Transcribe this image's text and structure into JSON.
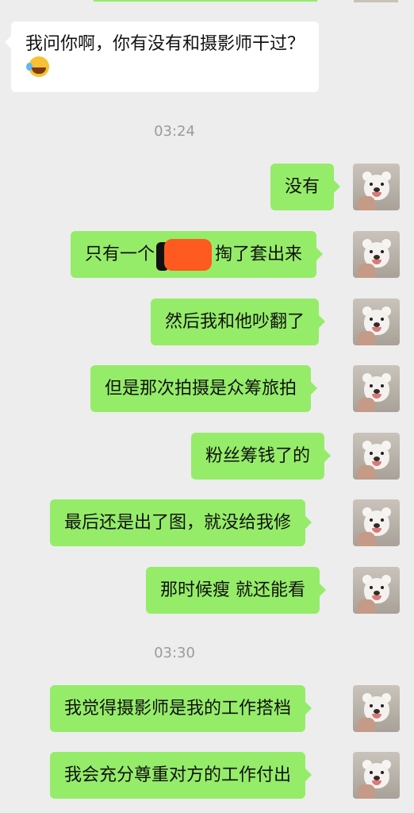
{
  "incoming": {
    "text": "我问你啊，你有没有和摄影师干过？",
    "emoji_icon": "crying-laughing-emoji-icon"
  },
  "timestamps": [
    "03:24",
    "03:30"
  ],
  "outgoing": [
    {
      "text": "没有"
    },
    {
      "before": "只有一个",
      "after": "掏了套出来",
      "redacted": true
    },
    {
      "text": "然后我和他吵翻了"
    },
    {
      "text": "但是那次拍摄是众筹旅拍"
    },
    {
      "text": "粉丝筹钱了的"
    },
    {
      "text": "最后还是出了图，就没给我修"
    },
    {
      "text": "那时候瘦 就还能看"
    },
    {
      "text": "我觉得摄影师是我的工作搭档"
    },
    {
      "text": "我会充分尊重对方的工作付出"
    }
  ],
  "colors": {
    "background": "#ededed",
    "outgoing_bubble": "#95ec69",
    "incoming_bubble": "#ffffff",
    "timestamp": "#9b9b9b",
    "redaction": "#ff5a1f"
  }
}
